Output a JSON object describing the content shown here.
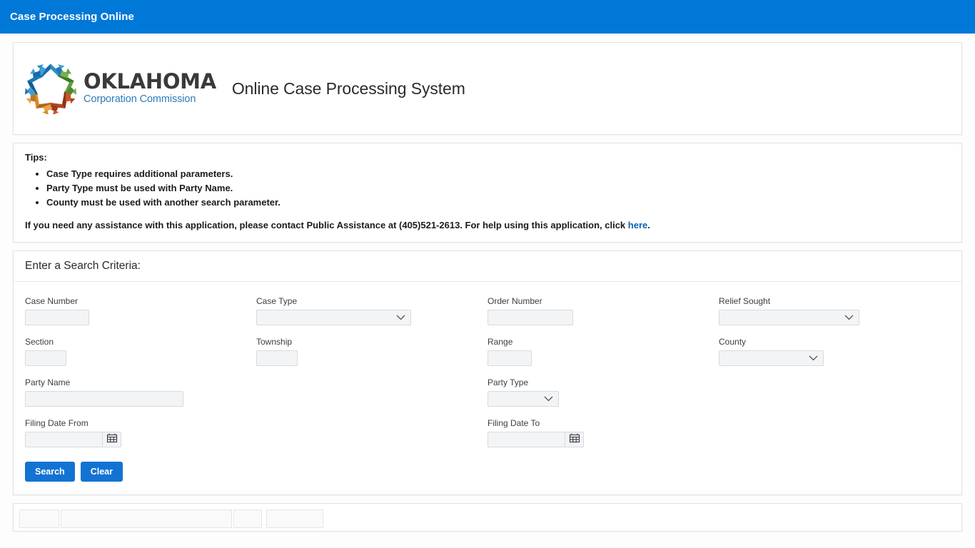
{
  "appbar": {
    "title": "Case Processing Online"
  },
  "brand": {
    "logo_icon": "oklahoma-corporation-commission-pinwheel-logo",
    "logo_line1": "OKLAHOMA",
    "logo_line2": "Corporation Commission",
    "app_title": "Online Case Processing System",
    "colors": {
      "blue_dark": "#1a6aa8",
      "blue_light": "#3f9ed6",
      "teal": "#2f8fc4",
      "green": "#5f9e3a",
      "green_dark": "#3f7a26",
      "orange": "#d98a2b",
      "orange_dark": "#b5651d",
      "red": "#b5441f",
      "red_dark": "#8e3315"
    }
  },
  "tips": {
    "heading": "Tips:",
    "items": [
      "Case Type requires additional parameters.",
      "Party Type must be used with Party Name.",
      "County must be used with another search parameter."
    ],
    "note_before": "If you need any assistance with this application, please contact Public Assistance at (405)521-2613. For help using this application, click ",
    "note_link": "here",
    "note_after": "."
  },
  "search": {
    "heading": "Enter a Search Criteria:",
    "fields": {
      "case_number": {
        "label": "Case Number",
        "value": "",
        "placeholder": ""
      },
      "case_type": {
        "label": "Case Type",
        "value": "",
        "icon": "chevron-down-icon"
      },
      "order_number": {
        "label": "Order Number",
        "value": "",
        "placeholder": ""
      },
      "relief_sought": {
        "label": "Relief Sought",
        "value": "",
        "icon": "chevron-down-icon"
      },
      "section": {
        "label": "Section",
        "value": "",
        "placeholder": ""
      },
      "township": {
        "label": "Township",
        "value": "",
        "placeholder": ""
      },
      "range": {
        "label": "Range",
        "value": "",
        "placeholder": ""
      },
      "county": {
        "label": "County",
        "value": "",
        "icon": "chevron-down-icon"
      },
      "party_name": {
        "label": "Party Name",
        "value": "",
        "placeholder": ""
      },
      "party_type": {
        "label": "Party Type",
        "value": "",
        "icon": "chevron-down-icon"
      },
      "filing_date_from": {
        "label": "Filing Date From",
        "value": "",
        "icon": "calendar-icon"
      },
      "filing_date_to": {
        "label": "Filing Date To",
        "value": "",
        "icon": "calendar-icon"
      }
    },
    "buttons": {
      "search": "Search",
      "clear": "Clear"
    }
  },
  "theme": {
    "appbar_blue": "#0078d7",
    "button_blue": "#1273d2",
    "link_blue": "#0a64b4",
    "field_bg": "#f3f4f5",
    "field_border": "#d8dade"
  }
}
